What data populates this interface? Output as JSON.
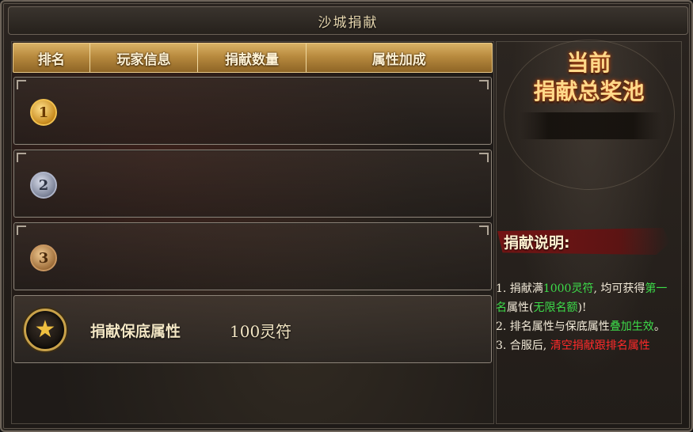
{
  "window": {
    "title": "沙城捐献"
  },
  "table": {
    "headers": [
      "排名",
      "玩家信息",
      "捐献数量",
      "属性加成"
    ],
    "ranks": [
      {
        "medal": "1",
        "tier": "gold"
      },
      {
        "medal": "2",
        "tier": "silver"
      },
      {
        "medal": "3",
        "tier": "bronze"
      }
    ],
    "guarantee": {
      "label": "捐献保底属性",
      "value": "100灵符"
    }
  },
  "pool": {
    "title_line1": "当前",
    "title_line2": "捐献总奖池"
  },
  "description": {
    "title": "捐献说明:",
    "line1_a": "1. 捐献满",
    "line1_b": "1000灵符",
    "line1_c": ", 均可获得",
    "line1_d": "第一",
    "line1_e": "名",
    "line1_f": "属性(",
    "line1_g": "无限名额",
    "line1_h": ")!",
    "line2_a": "2. 排名属性与保底属性",
    "line2_b": "叠加生效",
    "line2_c": "。",
    "line3_a": "3. 合服后, ",
    "line3_b": "清空捐献跟排名属性"
  },
  "colors": {
    "highlight_green": "#3ddc4a",
    "highlight_red": "#ff2a2a",
    "header_gold": "#d9b266"
  },
  "icons": {
    "corners": "ornament-corner-icon",
    "guarantee": "star-icon"
  }
}
